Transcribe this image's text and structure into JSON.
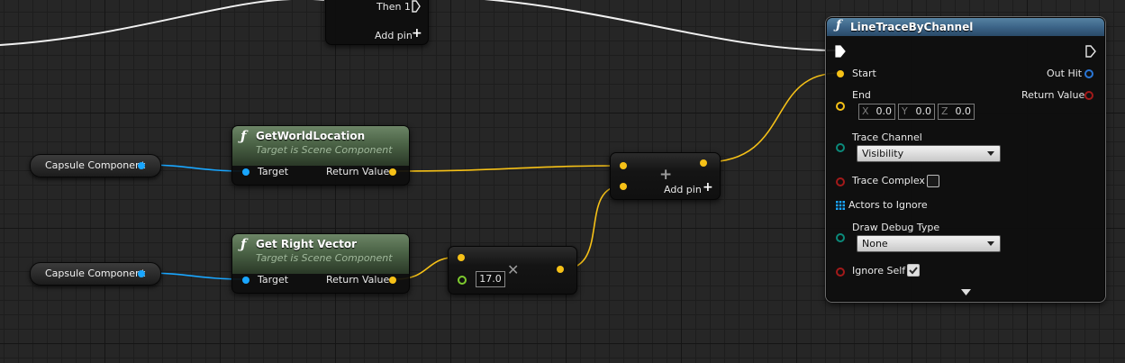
{
  "sequence_node": {
    "then_label": "Then 1",
    "add_pin_label": "Add pin"
  },
  "var_node_1": {
    "label": "Capsule Component"
  },
  "var_node_2": {
    "label": "Capsule Component"
  },
  "get_world_location": {
    "title": "GetWorldLocation",
    "subtitle": "Target is Scene Component",
    "target_label": "Target",
    "return_label": "Return Value"
  },
  "get_right_vector": {
    "title": "Get Right Vector",
    "subtitle": "Target is Scene Component",
    "target_label": "Target",
    "return_label": "Return Value"
  },
  "multiply_node": {
    "value": "17.0",
    "operator_icon": "multiply-icon"
  },
  "add_node": {
    "add_pin_label": "Add pin",
    "operator_icon": "plus-icon"
  },
  "line_trace": {
    "title": "LineTraceByChannel",
    "start_label": "Start",
    "end_label": "End",
    "end_vector": {
      "x_axis": "X",
      "x": "0.0",
      "y_axis": "Y",
      "y": "0.0",
      "z_axis": "Z",
      "z": "0.0"
    },
    "trace_channel_label": "Trace Channel",
    "trace_channel_value": "Visibility",
    "trace_complex_label": "Trace Complex",
    "trace_complex_checked": false,
    "actors_to_ignore_label": "Actors to Ignore",
    "draw_debug_label": "Draw Debug Type",
    "draw_debug_value": "None",
    "ignore_self_label": "Ignore Self",
    "ignore_self_checked": true,
    "out_hit_label": "Out Hit",
    "return_label": "Return Value"
  },
  "colors": {
    "vector_pin": "#f6c117",
    "object_pin": "#19a6ff",
    "struct_pin": "#2a76d6",
    "bool_pin": "#a31a1a",
    "enum_pin": "#0b8a7a",
    "float_pin": "#7ecb2e",
    "function_header": "#4b6346",
    "pure_call_header": "#3c6488",
    "exec_wire": "#ffffff"
  }
}
